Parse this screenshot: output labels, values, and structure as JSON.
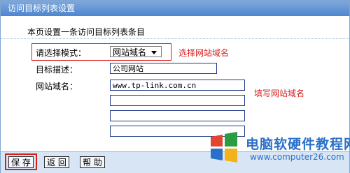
{
  "header": {
    "title": "访问目标列表设置"
  },
  "form": {
    "subtitle": "本页设置一条访问目标列表条目",
    "mode_label": "请选择模式：",
    "mode_value": "网站域名",
    "mode_note": "选择网站域名",
    "desc_label": "目标描述：",
    "desc_value": "公司网站",
    "domain_label": "网站域名：",
    "domain_values": [
      "www.tp-link.com.cn",
      "",
      "",
      ""
    ],
    "domain_note": "填写网站域名"
  },
  "buttons": {
    "save": "保 存",
    "back": "返 回",
    "help": "帮 助"
  },
  "watermark": {
    "title": "电脑软硬件教程网",
    "url": "www.computer26.com"
  },
  "colors": {
    "accent": "#4f86cf",
    "highlight": "#d62020"
  }
}
